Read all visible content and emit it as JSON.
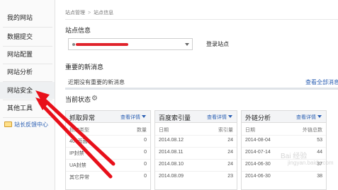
{
  "sidebar": {
    "items": [
      {
        "label": "我的网站"
      },
      {
        "label": "数据提交"
      },
      {
        "label": "网站配置"
      },
      {
        "label": "网站分析"
      },
      {
        "label": "网站安全"
      },
      {
        "label": "其他工具"
      }
    ],
    "feedback_label": "站长反馈中心",
    "feedback_icon": "envelope-icon"
  },
  "breadcrumb": {
    "first": "站点管理",
    "separator": ">",
    "second": "站点信息"
  },
  "site_info": {
    "title": "站点信息",
    "selected_site_redacted": true,
    "login_label": "登录站点"
  },
  "news": {
    "title": "重要的新消息",
    "empty_text": "近期没有重要的新消息",
    "view_all_label": "查看全部消息"
  },
  "status": {
    "title": "当前状态",
    "settings_icon": "gear-icon"
  },
  "panels": [
    {
      "title": "抓取异常",
      "more_label": "查看详情",
      "col1": "抓取类型",
      "col2": "数量",
      "rows": [
        {
          "c1": "404页面",
          "c2": "0"
        },
        {
          "c1": "IP封禁",
          "c2": "0"
        },
        {
          "c1": "UA封禁",
          "c2": "0"
        },
        {
          "c1": "其它异常",
          "c2": "0"
        }
      ]
    },
    {
      "title": "百度索引量",
      "more_label": "查看详情",
      "col1": "日期",
      "col2": "索引量",
      "rows": [
        {
          "c1": "2014.08.12",
          "c2": "24"
        },
        {
          "c1": "2014.08.11",
          "c2": "24"
        },
        {
          "c1": "2014.08.10",
          "c2": "24"
        },
        {
          "c1": "2014.08.09",
          "c2": "23"
        }
      ]
    },
    {
      "title": "外链分析",
      "more_label": "查看详情",
      "col1": "日期",
      "col2": "外链总数",
      "rows": [
        {
          "c1": "2014-08-04",
          "c2": "53"
        },
        {
          "c1": "2014-07-14",
          "c2": "44"
        },
        {
          "c1": "2014-06-30",
          "c2": "37"
        },
        {
          "c1": "2014-06-30",
          "c2": "38"
        }
      ]
    }
  ],
  "watermark": {
    "line1": "Bai 经验",
    "line2": "jingyan.baidu.com"
  },
  "annotation": {
    "arrow_color": "#e8101a"
  },
  "colors": {
    "link": "#2b5fb3",
    "sidebar_bg": "#fafafa",
    "active_item_bg": "#eef0f2"
  }
}
